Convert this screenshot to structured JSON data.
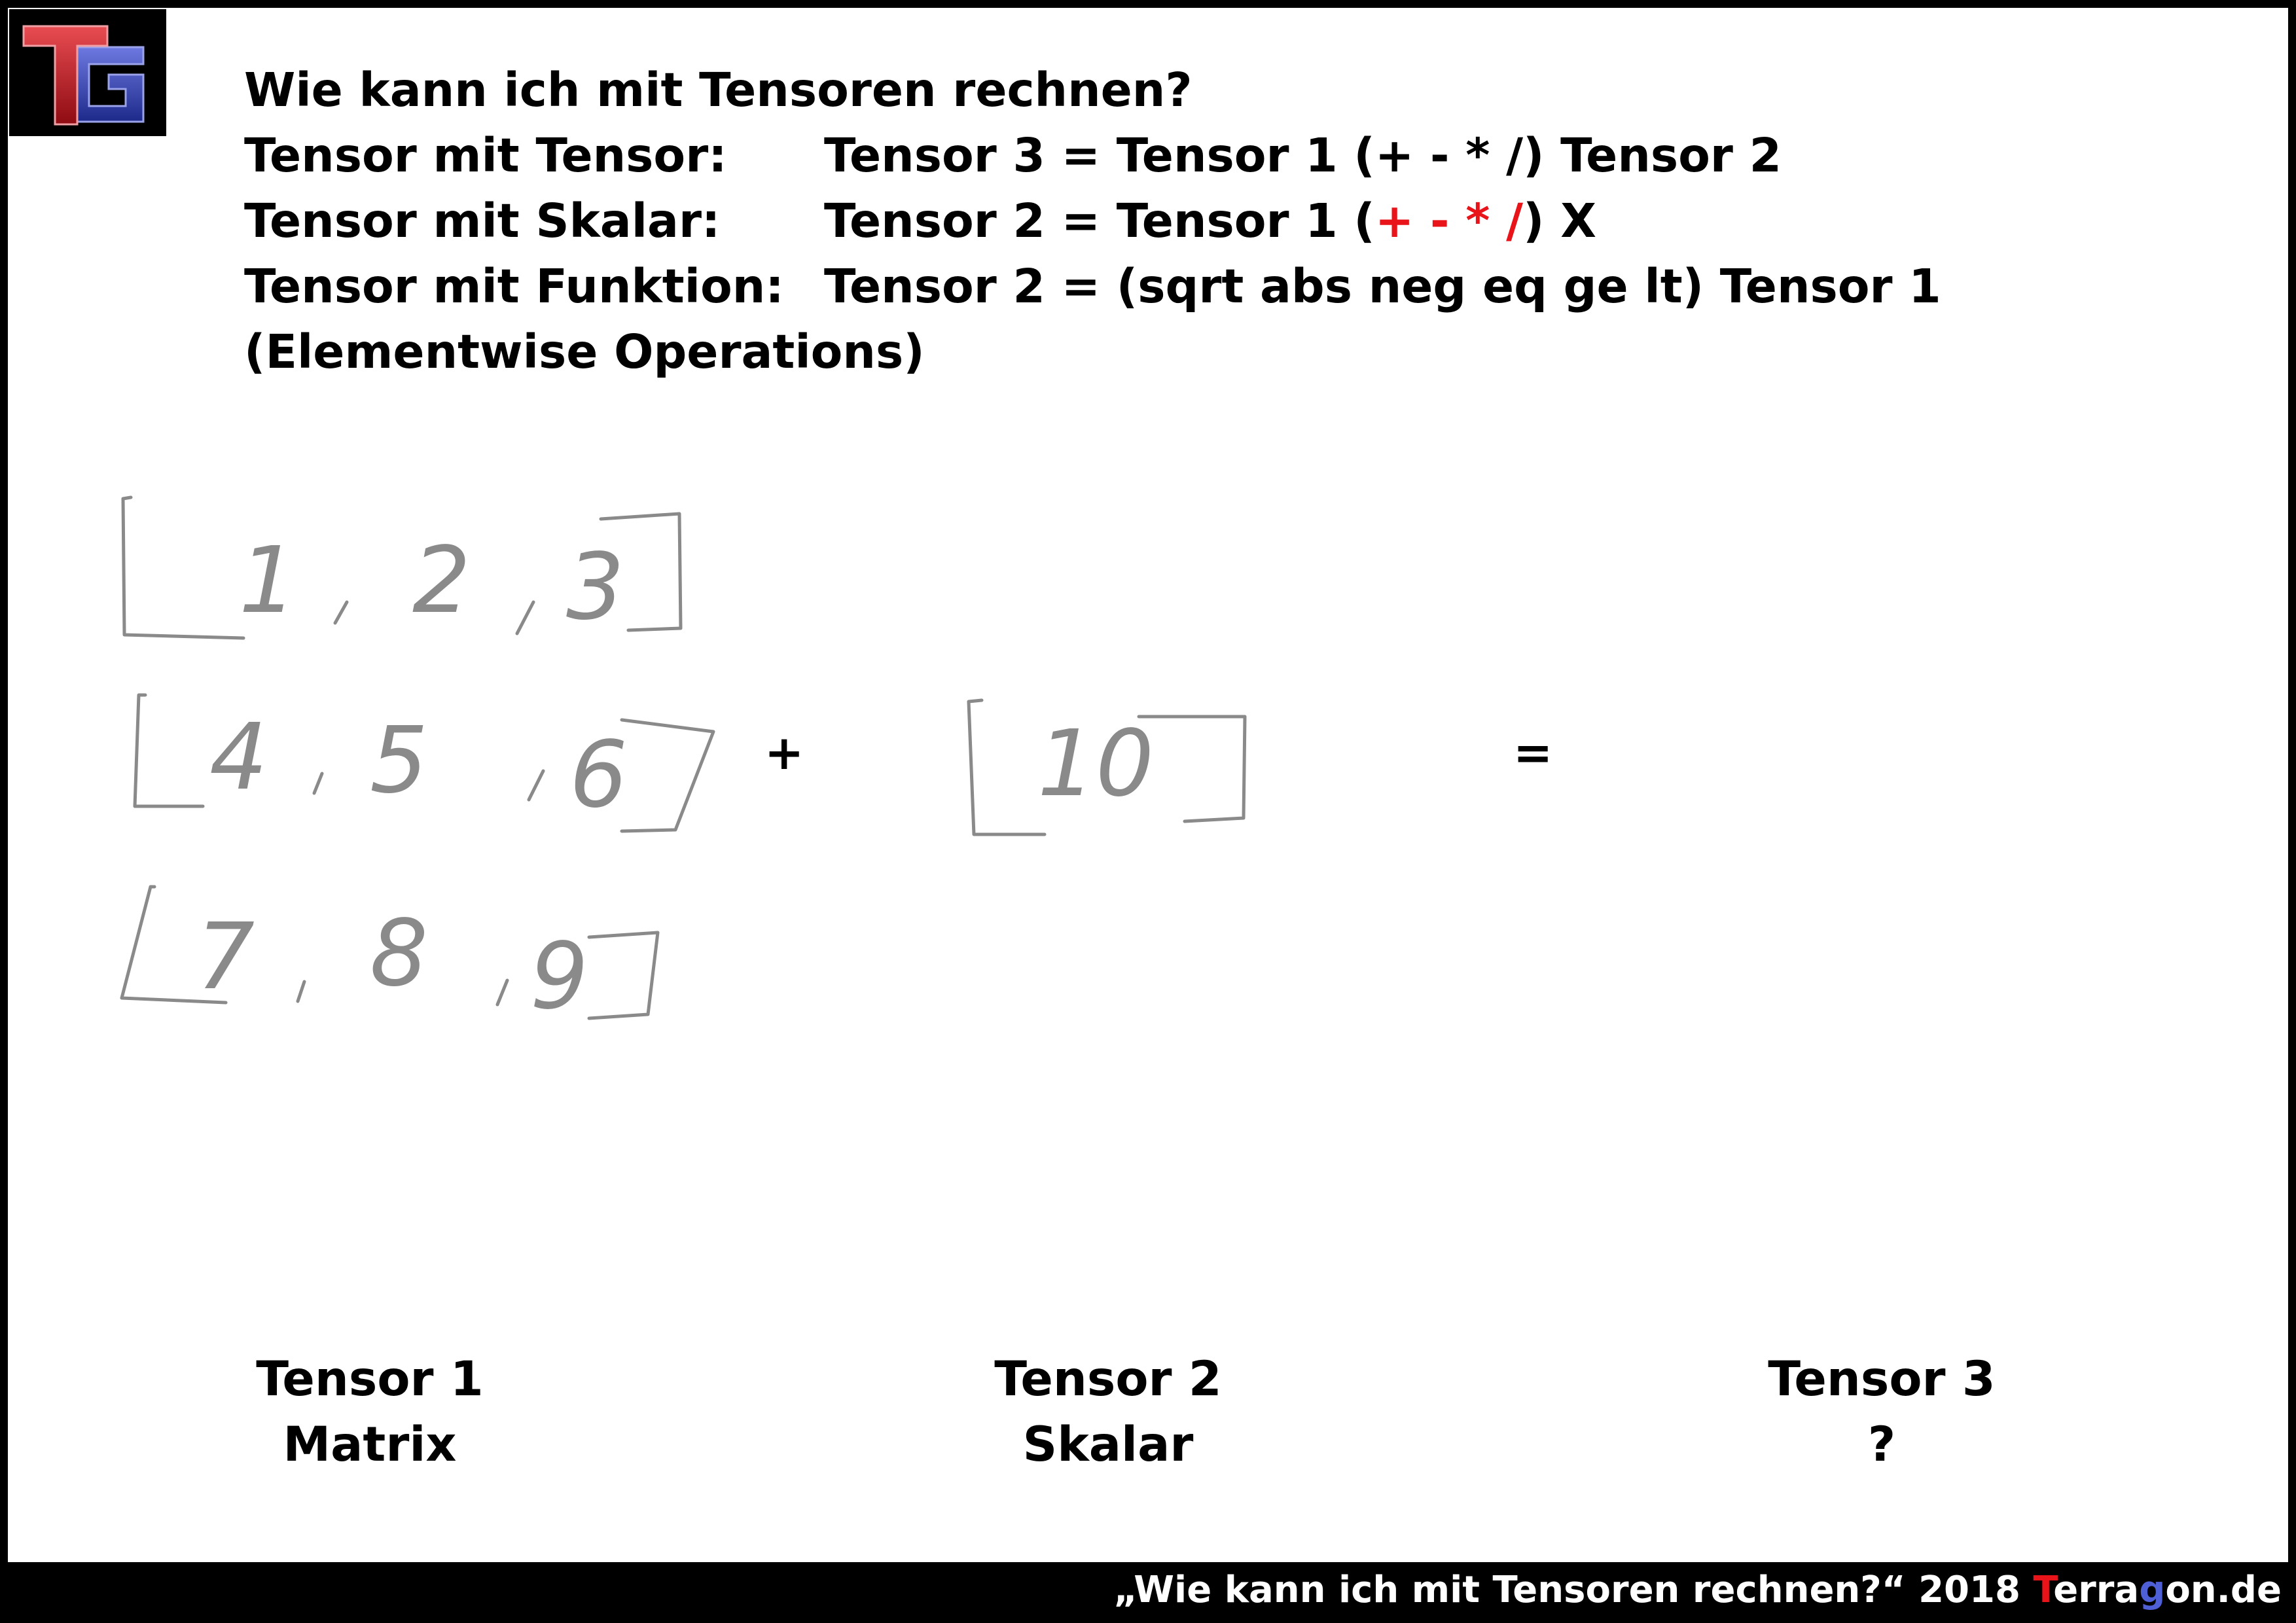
{
  "logo": {
    "text": "TG",
    "colors": {
      "t": "#c8141c",
      "g": "#2d3aa8"
    }
  },
  "title": "Wie kann ich mit Tensoren rechnen?",
  "rows": [
    {
      "label": "Tensor mit Tensor:",
      "formula": {
        "pre": "Tensor 3 = Tensor 1 (+ - * /) Tensor 2"
      }
    },
    {
      "label": "Tensor mit Skalar:",
      "formula": {
        "pre": "Tensor 2 = Tensor 1 (",
        "red": "+ - * /",
        "post": ") X"
      }
    },
    {
      "label": "Tensor mit Funktion:",
      "formula": {
        "pre": "Tensor 2 = (sqrt abs neg eq ge lt) Tensor 1"
      }
    }
  ],
  "subtitle": "(Elementwise Operations)",
  "handwriting": {
    "matrix_rows": [
      [
        "1",
        "2",
        "3"
      ],
      [
        "4",
        "5",
        "6"
      ],
      [
        "7",
        "8",
        "9"
      ]
    ],
    "scalar": "10",
    "plus": "+",
    "equals": "=",
    "ink_color": "#8a8a8a"
  },
  "captions": [
    {
      "name": "Tensor 1",
      "kind": "Matrix"
    },
    {
      "name": "Tensor 2",
      "kind": "Skalar"
    },
    {
      "name": "Tensor 3",
      "kind": "?"
    }
  ],
  "footer": {
    "quote": "„Wie kann ich mit Tensoren rechnen?“ 2018 ",
    "brand_t": "T",
    "brand_mid1": "erra",
    "brand_g": "g",
    "brand_mid2": "on.de",
    "colors": {
      "t": "#e8141a",
      "g": "#4f5fd6"
    }
  }
}
